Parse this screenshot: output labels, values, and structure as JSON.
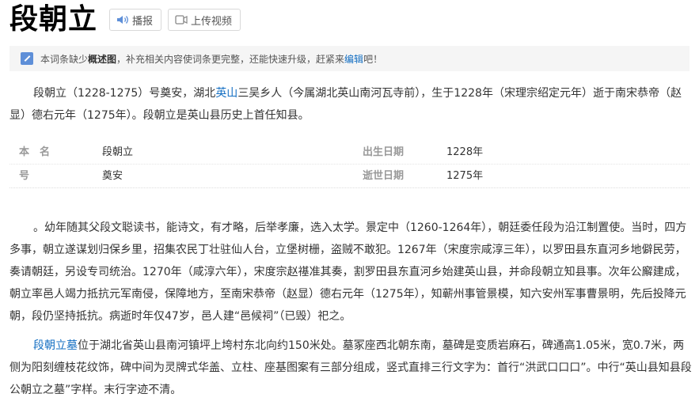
{
  "header": {
    "title": "段朝立",
    "play_label": "播报",
    "upload_label": "上传视频"
  },
  "notice": {
    "part1": "本词条缺少",
    "bold": "概述图",
    "part2": "，补充相关内容使词条更完整，还能快速升级，赶紧来",
    "link": "编辑",
    "part3": "吧！"
  },
  "intro": {
    "part1": "段朝立（1228-1275）号奠安，湖北",
    "link": "英山",
    "part2": "三吴乡人（今属湖北英山南河瓦寺前），生于1228年（宋理宗绍定元年）逝于南宋恭帝（赵显）德右元年（1275年）。段朝立是英山县历史上首任知县。"
  },
  "infobox": {
    "name_label": "本　名",
    "name_value": "段朝立",
    "birth_label": "出生日期",
    "birth_value": "1228年",
    "alias_label": "号",
    "alias_value": "奠安",
    "death_label": "逝世日期",
    "death_value": "1275年"
  },
  "life": {
    "text": "。幼年随其父段文聪读书，能诗文，有才略，后举孝廉，选入太学。景定中（1260-1264年），朝廷委任段为沿江制置使。当时，四方多事，朝立遂谋划归保乡里，招集农民丁壮驻仙人台，立堡树栅，盗贼不敢犯。1267年（宋度宗咸淳三年），以罗田县东直河乡地僻民劳，奏请朝廷，另设专司统治。1270年（咸淳六年），宋度宗赵禥准其奏，割罗田县东直河乡始建英山县，并命段朝立知县事。次年公廨建成，朝立率邑人竭力抵抗元军南侵，保障地方，至南宋恭帝（赵显）德右元年（1275年），知蕲州事管景模，知六安州军事曹景明，先后投降元朝，段仍坚持抵抗。病逝时年仅47岁，邑人建“邑候祠”（已毁）祀之。"
  },
  "tomb": {
    "link": "段朝立墓",
    "text": "位于湖北省英山县南河镇坪上垮村东北向约150米处。墓冢座西北朝东南，墓碑是变质岩麻石，碑通高1.05米，宽0.7米，两侧为阳刻缠枝花纹饰，碑中间为灵牌式华盖、立柱、座基图案有三部分组成，竖式直排三行文字为：首行“洪武口口口”。中行“英山县知县段公朝立之墓”字样。末行字迹不清。"
  }
}
